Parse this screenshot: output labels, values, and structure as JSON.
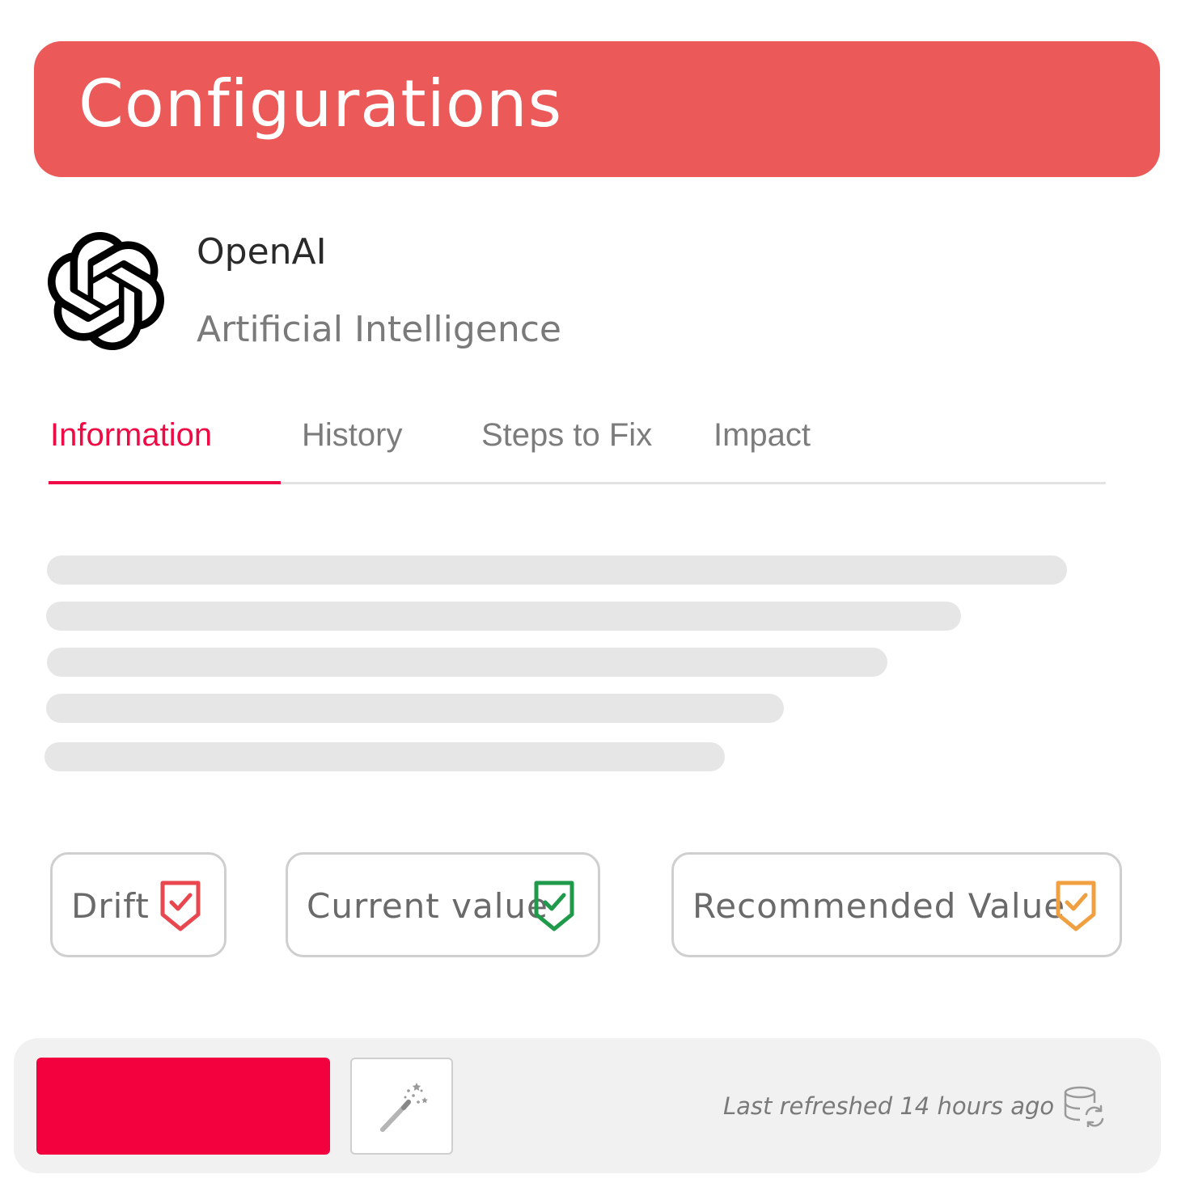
{
  "header": {
    "title": "Configurations"
  },
  "integration": {
    "name": "OpenAI",
    "category": "Artificial Intelligence",
    "logo_icon": "openai-logo-icon"
  },
  "tabs": [
    {
      "label": "Information",
      "active": true
    },
    {
      "label": "History",
      "active": false
    },
    {
      "label": "Steps to Fix",
      "active": false
    },
    {
      "label": "Impact",
      "active": false
    }
  ],
  "chips": [
    {
      "label": "Drift",
      "icon": "shield-check-icon",
      "color": "#e8474f"
    },
    {
      "label": "Current value",
      "icon": "shield-check-icon",
      "color": "#1f9a4a"
    },
    {
      "label": "Recommended Value",
      "icon": "shield-check-icon",
      "color": "#f0a040"
    }
  ],
  "footer": {
    "refresh_text": "Last refreshed 14 hours ago",
    "magic_icon": "magic-wand-icon",
    "refresh_icon": "database-refresh-icon"
  },
  "colors": {
    "header_bg": "#ec5959",
    "accent": "#ef0a45",
    "primary_button": "#f3003f"
  }
}
